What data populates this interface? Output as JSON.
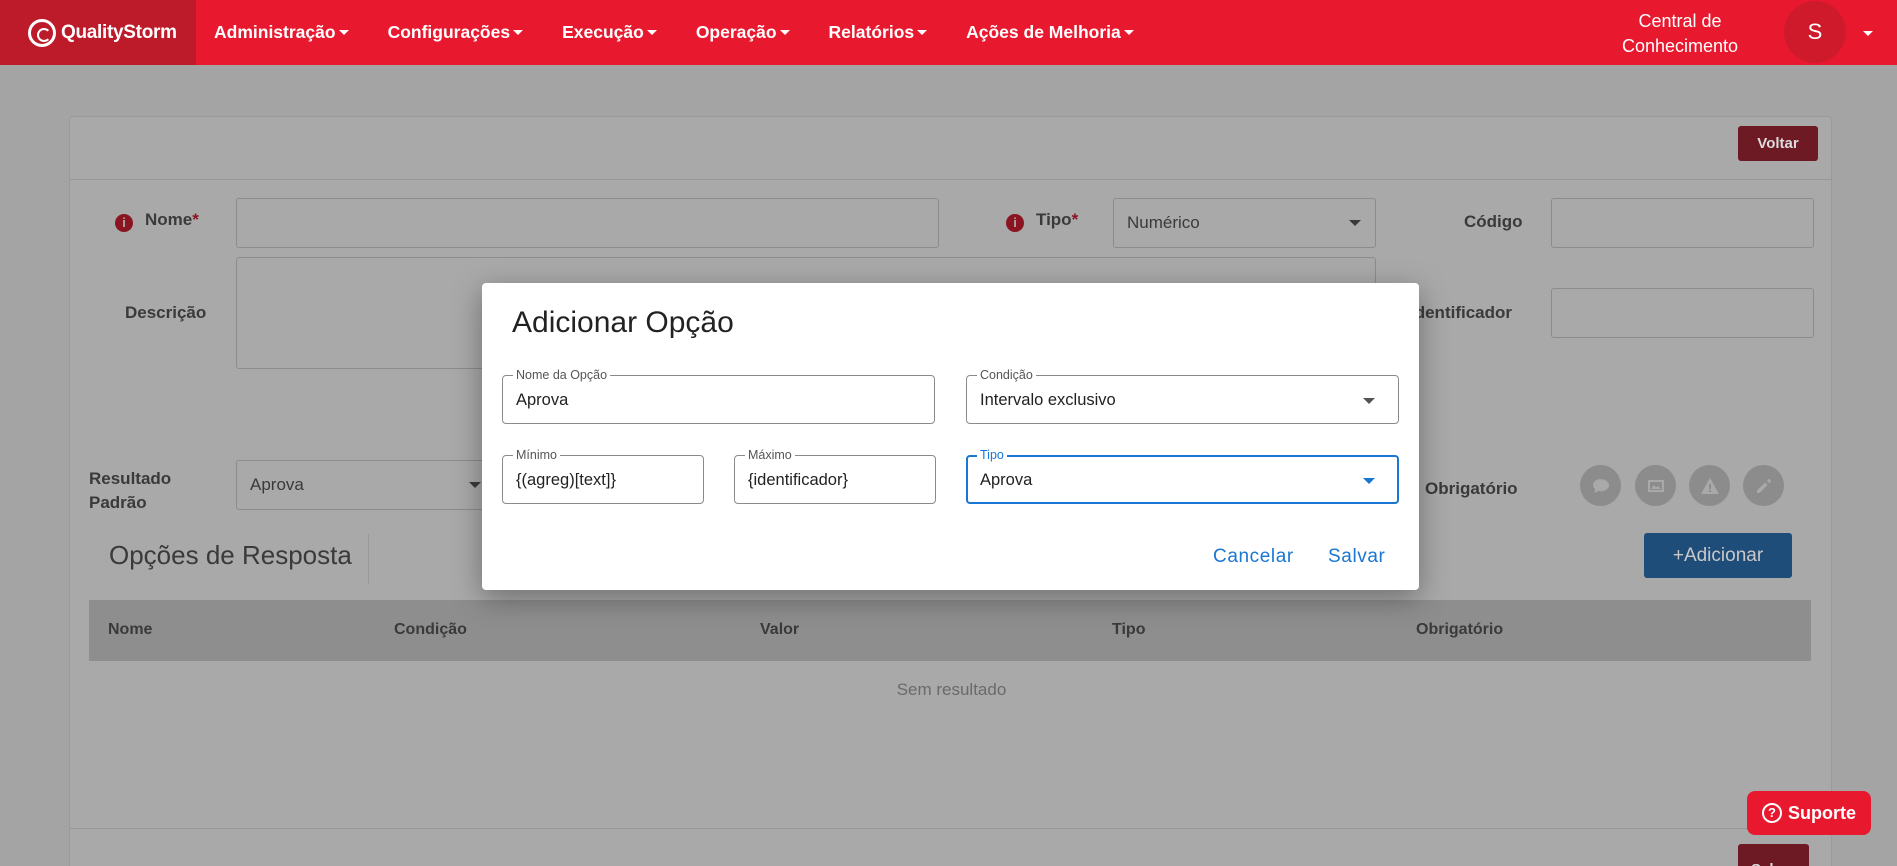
{
  "navbar": {
    "logo_text": "QualityStorm",
    "menu": [
      {
        "label": "Administração"
      },
      {
        "label": "Configurações"
      },
      {
        "label": "Execução"
      },
      {
        "label": "Operação"
      },
      {
        "label": "Relatórios"
      },
      {
        "label": "Ações de Melhoria"
      }
    ],
    "knowledge_line1": "Central de",
    "knowledge_line2": "Conhecimento",
    "avatar_initial": "S",
    "accent_color": "#e8192f"
  },
  "page": {
    "back_button": "Voltar",
    "labels": {
      "nome": "Nome",
      "tipo": "Tipo",
      "codigo": "Código",
      "descricao": "Descrição",
      "identificador": "Identificador",
      "resultado_padrao_1": "Resultado",
      "resultado_padrao_2": "Padrão",
      "obrigatorio": "Obrigatório",
      "required_mark": "*",
      "info_mark": "i"
    },
    "tipo_value": "Numérico",
    "resultado_padrao_value": "Aprova",
    "section_title": "Opções de Resposta",
    "add_button": "+Adicionar",
    "table_columns": [
      "Nome",
      "Condição",
      "Valor",
      "Tipo",
      "Obrigatório"
    ],
    "empty_text": "Sem resultado",
    "save_button": "Salvar",
    "action_icons": [
      "comment-icon",
      "image-icon",
      "warning-icon",
      "edit-icon"
    ]
  },
  "support_button": "Suporte",
  "modal": {
    "title": "Adicionar Opção",
    "option_name": {
      "label": "Nome da Opção",
      "value": "Aprova"
    },
    "condition": {
      "label": "Condição",
      "value": "Intervalo exclusivo"
    },
    "minimum": {
      "label": "Mínimo",
      "value": "{(agreg)[text]}"
    },
    "maximum": {
      "label": "Máximo",
      "value": "{identificador}"
    },
    "type": {
      "label": "Tipo",
      "value": "Aprova"
    },
    "cancel_button": "Cancelar",
    "save_button": "Salvar",
    "focus_color": "#1976d2"
  }
}
